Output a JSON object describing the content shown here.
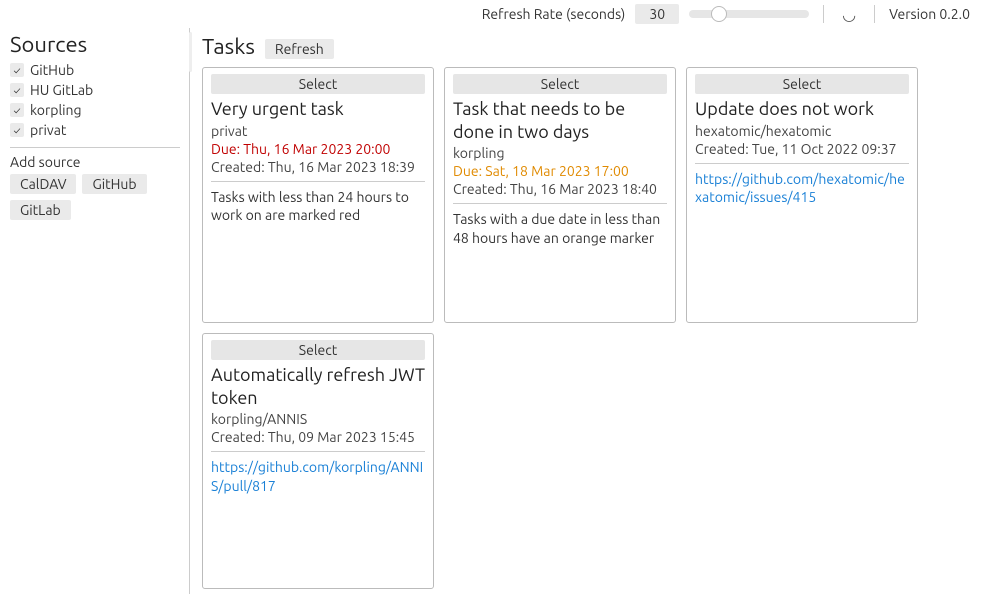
{
  "topbar": {
    "rate_label": "Refresh Rate (seconds)",
    "rate_value": "30",
    "version": "Version 0.2.0"
  },
  "sidebar": {
    "title": "Sources",
    "sources": [
      {
        "label": "GitHub",
        "checked": true
      },
      {
        "label": "HU GitLab",
        "checked": true
      },
      {
        "label": "korpling",
        "checked": true
      },
      {
        "label": "privat",
        "checked": true
      }
    ],
    "add_label": "Add source",
    "add_buttons": [
      "CalDAV",
      "GitHub",
      "GitLab"
    ]
  },
  "main": {
    "title": "Tasks",
    "refresh_label": "Refresh",
    "select_label": "Select",
    "tasks": [
      {
        "title": "Very urgent task",
        "project": "privat",
        "due": "Due: Thu, 16 Mar 2023 20:00",
        "due_state": "overdue",
        "created": "Created: Thu, 16 Mar 2023 18:39",
        "desc": "Tasks with less than 24 hours to work on are marked red",
        "link": ""
      },
      {
        "title": "Task that needs to be done in two days",
        "project": "korpling",
        "due": "Due: Sat, 18 Mar 2023 17:00",
        "due_state": "soon",
        "created": "Created: Thu, 16 Mar 2023 18:40",
        "desc": "Tasks with a due date in less than 48 hours have an orange marker",
        "link": ""
      },
      {
        "title": "Update does not work",
        "project": "hexatomic/hexatomic",
        "due": "",
        "due_state": "",
        "created": "Created: Tue, 11 Oct 2022 09:37",
        "desc": "",
        "link": "https://github.com/hexatomic/hexatomic/issues/415"
      },
      {
        "title": "Automatically refresh JWT token",
        "project": "korpling/ANNIS",
        "due": "",
        "due_state": "",
        "created": "Created: Thu, 09 Mar 2023 15:45",
        "desc": "",
        "link": "https://github.com/korpling/ANNIS/pull/817"
      }
    ]
  }
}
